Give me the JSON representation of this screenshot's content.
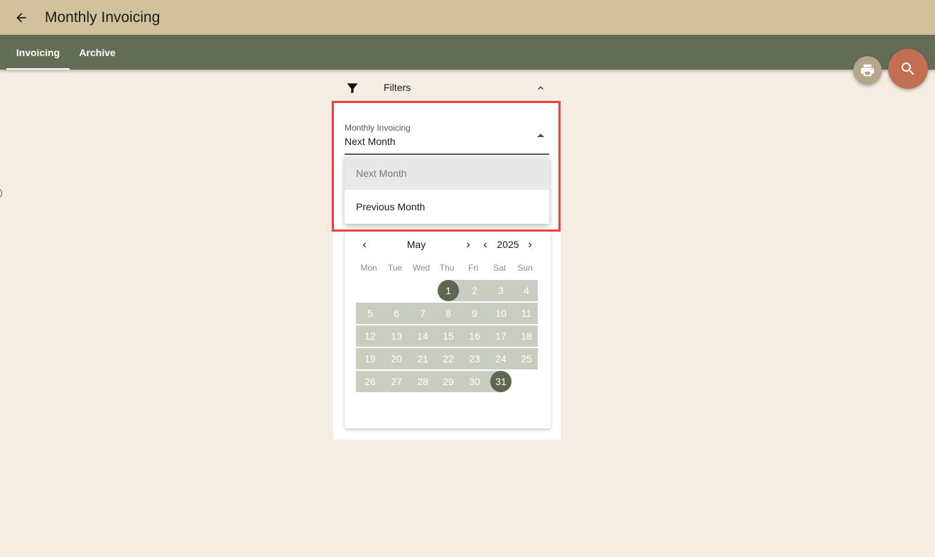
{
  "header": {
    "title": "Monthly Invoicing",
    "back_icon": "arrow-left-icon"
  },
  "tabs": [
    {
      "label": "Invoicing",
      "active": true
    },
    {
      "label": "Archive",
      "active": false
    }
  ],
  "actions": {
    "print_icon": "print-icon",
    "search_icon": "search-icon"
  },
  "filters": {
    "label": "Filters",
    "filter_icon": "filter-icon",
    "collapse_icon": "chevron-up-icon",
    "select": {
      "label": "Monthly Invoicing",
      "value": "Next Month",
      "options": [
        "Next Month",
        "Previous Month"
      ]
    }
  },
  "calendar": {
    "month": "May",
    "year": "2025",
    "weekdays": [
      "Mon",
      "Tue",
      "Wed",
      "Thu",
      "Fri",
      "Sat",
      "Sun"
    ],
    "weeks": [
      [
        "",
        "",
        "",
        "1",
        "2",
        "3",
        "4"
      ],
      [
        "5",
        "6",
        "7",
        "8",
        "9",
        "10",
        "11"
      ],
      [
        "12",
        "13",
        "14",
        "15",
        "16",
        "17",
        "18"
      ],
      [
        "19",
        "20",
        "21",
        "22",
        "23",
        "24",
        "25"
      ],
      [
        "26",
        "27",
        "28",
        "29",
        "30",
        "31",
        ""
      ]
    ],
    "selected_range": [
      "1",
      "31"
    ]
  },
  "colors": {
    "app_bar": "#d2c19c",
    "tab_bar": "#636d55",
    "background": "#f5ece2",
    "accent_fab": "#c26e53",
    "secondary_fab": "#b5a58b",
    "day_range": "#c9ccc0",
    "day_selected": "#5d6650",
    "highlight": "#e84242"
  }
}
